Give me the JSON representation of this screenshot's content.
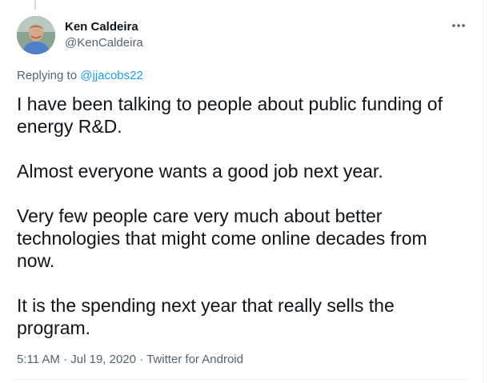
{
  "tweet": {
    "author": {
      "display_name": "Ken Caldeira",
      "handle": "@KenCaldeira",
      "avatar_icon": "person-photo-icon"
    },
    "more_icon": "more-options-icon",
    "replying_prefix": "Replying to",
    "replying_to": "@jjacobs22",
    "paragraphs": [
      "I have been talking to people about public funding of energy R&D.",
      "Almost everyone wants a good job next year.",
      "Very few people care very much about better technologies that might come online decades from now.",
      "It is the spending next year that really sells the program."
    ],
    "meta": {
      "time": "5:11 AM",
      "separator": "·",
      "date": "Jul 19, 2020",
      "source": "Twitter for Android"
    }
  },
  "colors": {
    "text": "#0f1419",
    "secondary": "#536471",
    "link": "#1d9bf0",
    "border": "#eff3f4"
  }
}
